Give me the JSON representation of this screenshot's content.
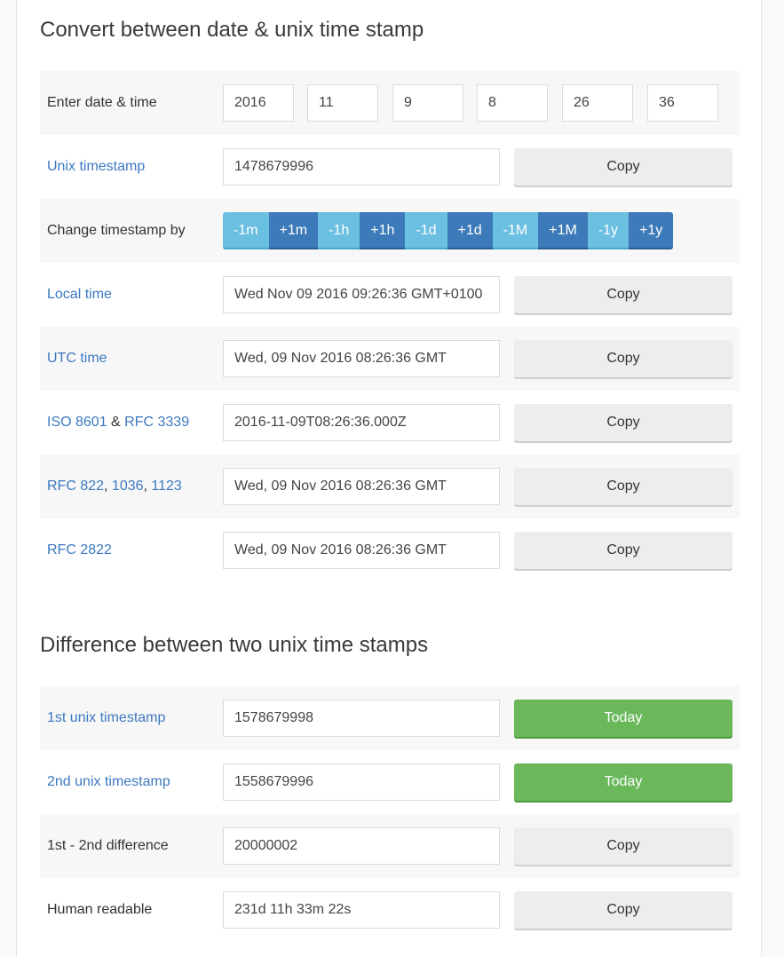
{
  "convert": {
    "title": "Convert between date & unix time stamp",
    "date_input": {
      "label": "Enter date & time",
      "year": "2016",
      "month": "11",
      "day": "9",
      "hour": "8",
      "minute": "26",
      "second": "36"
    },
    "unix": {
      "label": "Unix timestamp",
      "value": "1478679996",
      "button": "Copy"
    },
    "change": {
      "label": "Change timestamp by",
      "buttons": [
        "-1m",
        "+1m",
        "-1h",
        "+1h",
        "-1d",
        "+1d",
        "-1M",
        "+1M",
        "-1y",
        "+1y"
      ]
    },
    "local": {
      "label": "Local time",
      "value": "Wed Nov 09 2016 09:26:36 GMT+0100",
      "button": "Copy"
    },
    "utc": {
      "label": "UTC time",
      "value": "Wed, 09 Nov 2016 08:26:36 GMT",
      "button": "Copy"
    },
    "iso": {
      "label_a": "ISO 8601",
      "sep": " & ",
      "label_b": "RFC 3339",
      "value": "2016-11-09T08:26:36.000Z",
      "button": "Copy"
    },
    "rfc822": {
      "label_a": "RFC 822",
      "sep1": ", ",
      "label_b": "1036",
      "sep2": ", ",
      "label_c": "1123",
      "value": "Wed, 09 Nov 2016 08:26:36 GMT",
      "button": "Copy"
    },
    "rfc2822": {
      "label": "RFC 2822",
      "value": "Wed, 09 Nov 2016 08:26:36 GMT",
      "button": "Copy"
    }
  },
  "difference": {
    "title": "Difference between two unix time stamps",
    "first": {
      "label": "1st unix timestamp",
      "value": "1578679998",
      "button": "Today"
    },
    "second": {
      "label": "2nd unix timestamp",
      "value": "1558679996",
      "button": "Today"
    },
    "diff": {
      "label": "1st - 2nd difference",
      "value": "20000002",
      "button": "Copy"
    },
    "human": {
      "label": "Human readable",
      "value": "231d 11h 33m 22s",
      "button": "Copy"
    }
  },
  "colors": {
    "link": "#3c78c0",
    "step_minus": "#6bbfe0",
    "step_plus": "#3d7ab9",
    "today_green": "#6ab85a",
    "copy_gray": "#ededed"
  }
}
